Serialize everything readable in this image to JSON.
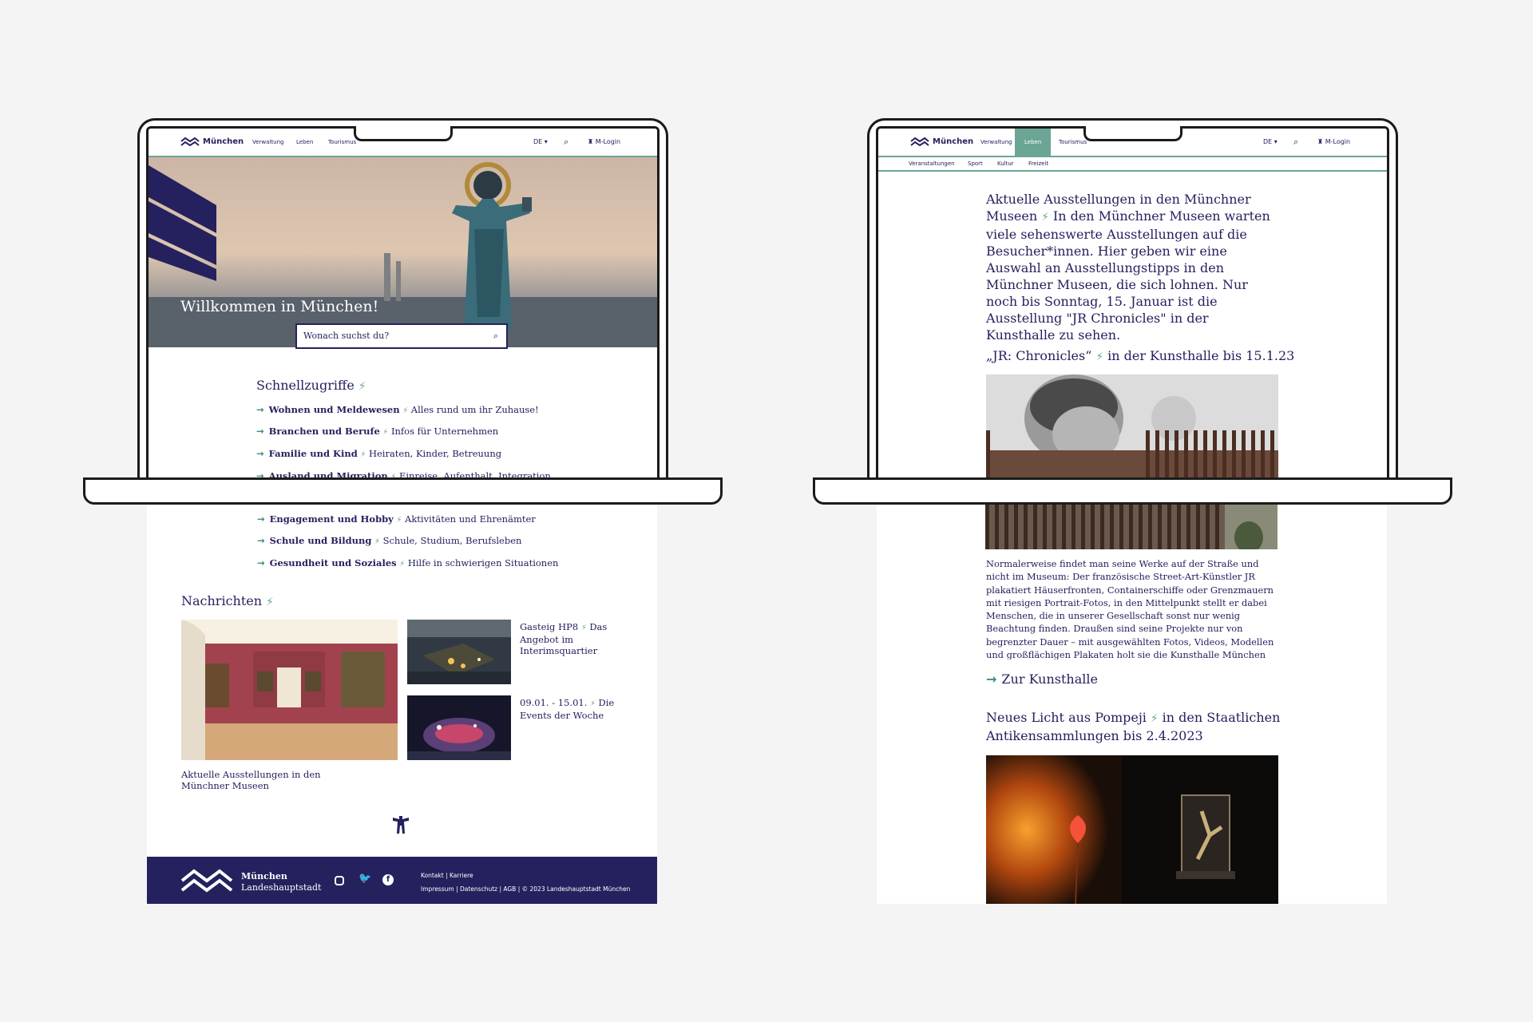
{
  "left": {
    "nav": {
      "brand": "München",
      "items": [
        "Verwaltung",
        "Leben",
        "Tourismus"
      ],
      "lang": "DE",
      "login": "M-Login"
    },
    "hero": {
      "title": "Willkommen in München!",
      "search_placeholder": "Wonach suchst du?"
    },
    "quick": {
      "title": "Schnellzugriffe",
      "items": [
        {
          "label": "Wohnen und Meldewesen",
          "desc": "Alles rund um ihr Zuhause!"
        },
        {
          "label": "Branchen und Berufe",
          "desc": "Infos für Unternehmen"
        },
        {
          "label": "Familie und Kind",
          "desc": "Heiraten, Kinder, Betreuung"
        },
        {
          "label": "Ausland und Migration",
          "desc": "Einreise, Aufenthalt, Integration"
        },
        {
          "label": "Engagement und Hobby",
          "desc": "Aktivitäten und Ehrenämter"
        },
        {
          "label": "Schule und Bildung",
          "desc": "Schule, Studium, Berufsleben"
        },
        {
          "label": "Gesundheit und Soziales",
          "desc": "Hilfe in schwierigen Situationen"
        }
      ]
    },
    "news": {
      "title": "Nachrichten",
      "main_caption": "Aktuelle Ausstellungen in den Münchner Museen",
      "item1_title": "Gasteig HP8",
      "item1_text": "Das Angebot im Interimsquartier",
      "item2_title": "09.01. - 15.01.",
      "item2_text": "Die Events der Woche"
    },
    "footer": {
      "brand": "München",
      "sub": "Landeshauptstadt",
      "links1": "Kontakt | Karriere",
      "links2": "Impressum | Datenschutz | AGB | © 2023 Landeshauptstadt München"
    }
  },
  "right": {
    "nav": {
      "brand": "München",
      "items": [
        "Verwaltung",
        "Leben",
        "Tourismus"
      ],
      "lang": "DE",
      "login": "M-Login",
      "sub": [
        "Veranstaltungen",
        "Sport",
        "Kultur",
        "Freizeit"
      ]
    },
    "intro_title": "Aktuelle Ausstellungen in den Münchner Museen",
    "intro_text": "In den Münchner Museen warten viele sehenswerte Ausstellungen auf die Besucher*innen. Hier geben wir eine Auswahl an Ausstellungstipps in den Münchner Museen, die sich lohnen. Nur noch bis Sonntag, 15. Januar ist die Ausstellung \"JR Chronicles\" in der Kunsthalle zu sehen.",
    "article1_title_a": "„JR: Chronicles“",
    "article1_title_b": "in der Kunsthalle bis 15.1.23",
    "article1_text": "Normalerweise findet man seine Werke auf der Straße und nicht im Museum: Der französische Street-Art-Künstler JR plakatiert Häuserfronten, Containerschiffe oder Grenzmauern mit riesigen Portrait-Fotos, in den Mittelpunkt stellt er dabei Menschen, die in unserer Gesellschaft sonst nur wenig Beachtung finden. Draußen sind seine Projekte nur von begrenzter Dauer – mit ausgewählten Fotos, Videos, Modellen und großflächigen Plakaten holt sie die Kunsthalle München für euch zurück.",
    "article1_link": "Zur Kunsthalle",
    "article2_title_a": "Neues Licht aus Pompeji",
    "article2_title_b": "in den Staatlichen Antikensammlungen bis 2.4.2023"
  },
  "colors": {
    "navy": "#25215e",
    "green": "#6aa596",
    "background": "#f4f4f4"
  },
  "icons": [
    "search-icon",
    "login-icon",
    "arrow-right-icon",
    "instagram-icon",
    "twitter-icon",
    "facebook-icon",
    "munich-logo-icon"
  ]
}
